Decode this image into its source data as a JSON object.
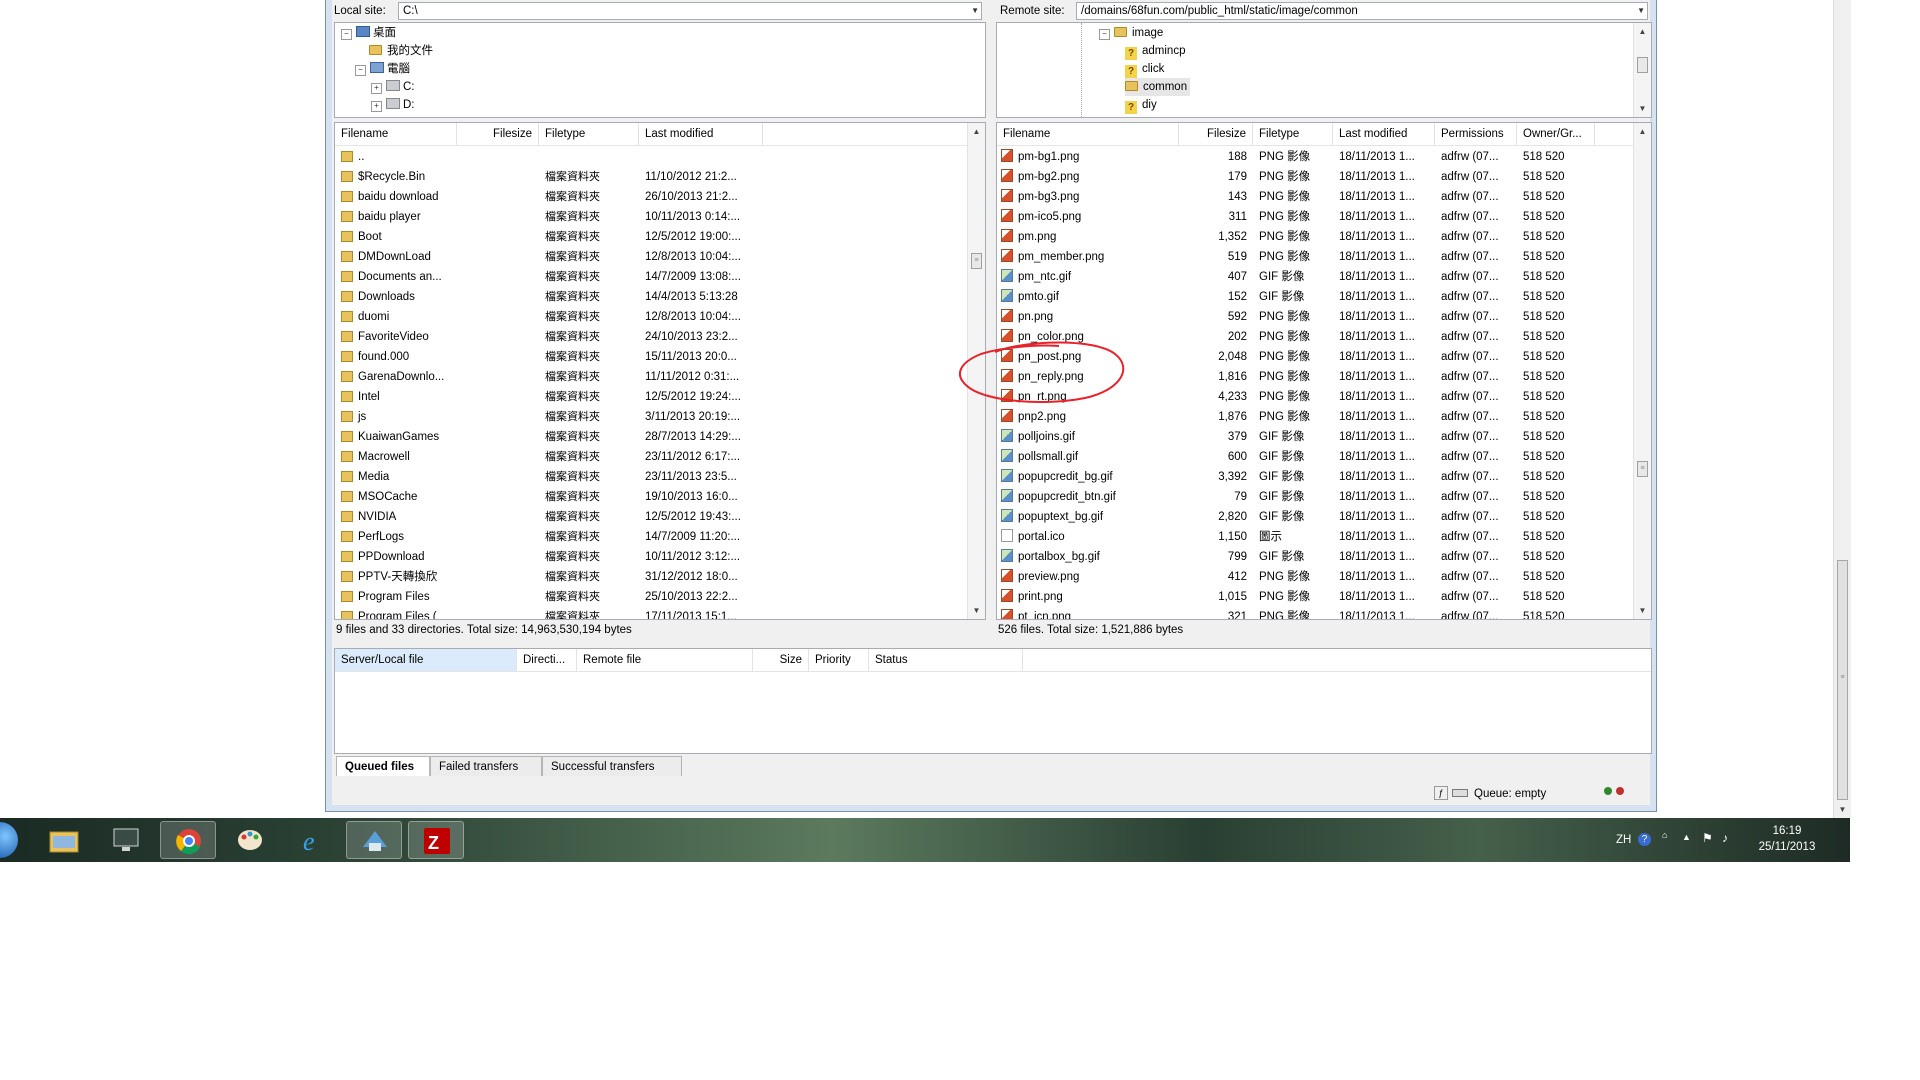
{
  "local": {
    "site_label": "Local site:",
    "site_path": "C:\\",
    "tree": [
      {
        "label": "桌面",
        "icon": "desktop-icon"
      },
      {
        "label": "我的文件",
        "icon": "folder-icon"
      },
      {
        "label": "電腦",
        "icon": "computer-icon"
      },
      {
        "label": "C:",
        "icon": "drive-icon"
      },
      {
        "label": "D:",
        "icon": "drive-icon"
      }
    ],
    "columns": [
      "Filename",
      "Filesize",
      "Filetype",
      "Last modified"
    ],
    "rows": [
      {
        "name": "..",
        "type": "",
        "modified": ""
      },
      {
        "name": "$Recycle.Bin",
        "type": "檔案資料夾",
        "modified": "11/10/2012 21:2..."
      },
      {
        "name": "baidu download",
        "type": "檔案資料夾",
        "modified": "26/10/2013 21:2..."
      },
      {
        "name": "baidu player",
        "type": "檔案資料夾",
        "modified": "10/11/2013 0:14:..."
      },
      {
        "name": "Boot",
        "type": "檔案資料夾",
        "modified": "12/5/2012 19:00:..."
      },
      {
        "name": "DMDownLoad",
        "type": "檔案資料夾",
        "modified": "12/8/2013 10:04:..."
      },
      {
        "name": "Documents an...",
        "type": "檔案資料夾",
        "modified": "14/7/2009 13:08:..."
      },
      {
        "name": "Downloads",
        "type": "檔案資料夾",
        "modified": "14/4/2013 5:13:28"
      },
      {
        "name": "duomi",
        "type": "檔案資料夾",
        "modified": "12/8/2013 10:04:..."
      },
      {
        "name": "FavoriteVideo",
        "type": "檔案資料夾",
        "modified": "24/10/2013 23:2..."
      },
      {
        "name": "found.000",
        "type": "檔案資料夾",
        "modified": "15/11/2013 20:0..."
      },
      {
        "name": "GarenaDownlo...",
        "type": "檔案資料夾",
        "modified": "11/11/2012 0:31:..."
      },
      {
        "name": "Intel",
        "type": "檔案資料夾",
        "modified": "12/5/2012 19:24:..."
      },
      {
        "name": "js",
        "type": "檔案資料夾",
        "modified": "3/11/2013 20:19:..."
      },
      {
        "name": "KuaiwanGames",
        "type": "檔案資料夾",
        "modified": "28/7/2013 14:29:..."
      },
      {
        "name": "Macrowell",
        "type": "檔案資料夾",
        "modified": "23/11/2012 6:17:..."
      },
      {
        "name": "Media",
        "type": "檔案資料夾",
        "modified": "23/11/2013 23:5..."
      },
      {
        "name": "MSOCache",
        "type": "檔案資料夾",
        "modified": "19/10/2013 16:0..."
      },
      {
        "name": "NVIDIA",
        "type": "檔案資料夾",
        "modified": "12/5/2012 19:43:..."
      },
      {
        "name": "PerfLogs",
        "type": "檔案資料夾",
        "modified": "14/7/2009 11:20:..."
      },
      {
        "name": "PPDownload",
        "type": "檔案資料夾",
        "modified": "10/11/2012 3:12:..."
      },
      {
        "name": "PPTV-天轉換欣",
        "type": "檔案資料夾",
        "modified": "31/12/2012 18:0..."
      },
      {
        "name": "Program Files",
        "type": "檔案資料夾",
        "modified": "25/10/2013 22:2..."
      },
      {
        "name": "Program Files (",
        "type": "檔案資料夾",
        "modified": "17/11/2013 15:1..."
      }
    ],
    "status": "9 files and 33 directories. Total size: 14,963,530,194 bytes"
  },
  "remote": {
    "site_label": "Remote site:",
    "site_path": "/domains/68fun.com/public_html/static/image/common",
    "tree": [
      {
        "label": "image",
        "icon": "folder-icon"
      },
      {
        "label": "admincp",
        "icon": "unknown-folder-icon"
      },
      {
        "label": "click",
        "icon": "unknown-folder-icon"
      },
      {
        "label": "common",
        "icon": "folder-icon"
      },
      {
        "label": "diy",
        "icon": "unknown-folder-icon"
      }
    ],
    "columns": [
      "Filename",
      "Filesize",
      "Filetype",
      "Last modified",
      "Permissions",
      "Owner/Gr..."
    ],
    "rows": [
      {
        "name": "pm-bg1.png",
        "size": "188",
        "type": "PNG 影像",
        "modified": "18/11/2013 1...",
        "perm": "adfrw (07...",
        "owner": "518 520",
        "icon": "png"
      },
      {
        "name": "pm-bg2.png",
        "size": "179",
        "type": "PNG 影像",
        "modified": "18/11/2013 1...",
        "perm": "adfrw (07...",
        "owner": "518 520",
        "icon": "png"
      },
      {
        "name": "pm-bg3.png",
        "size": "143",
        "type": "PNG 影像",
        "modified": "18/11/2013 1...",
        "perm": "adfrw (07...",
        "owner": "518 520",
        "icon": "png"
      },
      {
        "name": "pm-ico5.png",
        "size": "311",
        "type": "PNG 影像",
        "modified": "18/11/2013 1...",
        "perm": "adfrw (07...",
        "owner": "518 520",
        "icon": "png"
      },
      {
        "name": "pm.png",
        "size": "1,352",
        "type": "PNG 影像",
        "modified": "18/11/2013 1...",
        "perm": "adfrw (07...",
        "owner": "518 520",
        "icon": "png"
      },
      {
        "name": "pm_member.png",
        "size": "519",
        "type": "PNG 影像",
        "modified": "18/11/2013 1...",
        "perm": "adfrw (07...",
        "owner": "518 520",
        "icon": "png"
      },
      {
        "name": "pm_ntc.gif",
        "size": "407",
        "type": "GIF 影像",
        "modified": "18/11/2013 1...",
        "perm": "adfrw (07...",
        "owner": "518 520",
        "icon": "gif"
      },
      {
        "name": "pmto.gif",
        "size": "152",
        "type": "GIF 影像",
        "modified": "18/11/2013 1...",
        "perm": "adfrw (07...",
        "owner": "518 520",
        "icon": "gif"
      },
      {
        "name": "pn.png",
        "size": "592",
        "type": "PNG 影像",
        "modified": "18/11/2013 1...",
        "perm": "adfrw (07...",
        "owner": "518 520",
        "icon": "png"
      },
      {
        "name": "pn_color.png",
        "size": "202",
        "type": "PNG 影像",
        "modified": "18/11/2013 1...",
        "perm": "adfrw (07...",
        "owner": "518 520",
        "icon": "png"
      },
      {
        "name": "pn_post.png",
        "size": "2,048",
        "type": "PNG 影像",
        "modified": "18/11/2013 1...",
        "perm": "adfrw (07...",
        "owner": "518 520",
        "icon": "png"
      },
      {
        "name": "pn_reply.png",
        "size": "1,816",
        "type": "PNG 影像",
        "modified": "18/11/2013 1...",
        "perm": "adfrw (07...",
        "owner": "518 520",
        "icon": "png"
      },
      {
        "name": "pn_rt.png",
        "size": "4,233",
        "type": "PNG 影像",
        "modified": "18/11/2013 1...",
        "perm": "adfrw (07...",
        "owner": "518 520",
        "icon": "png"
      },
      {
        "name": "pnp2.png",
        "size": "1,876",
        "type": "PNG 影像",
        "modified": "18/11/2013 1...",
        "perm": "adfrw (07...",
        "owner": "518 520",
        "icon": "png"
      },
      {
        "name": "polljoins.gif",
        "size": "379",
        "type": "GIF 影像",
        "modified": "18/11/2013 1...",
        "perm": "adfrw (07...",
        "owner": "518 520",
        "icon": "gif"
      },
      {
        "name": "pollsmall.gif",
        "size": "600",
        "type": "GIF 影像",
        "modified": "18/11/2013 1...",
        "perm": "adfrw (07...",
        "owner": "518 520",
        "icon": "gif"
      },
      {
        "name": "popupcredit_bg.gif",
        "size": "3,392",
        "type": "GIF 影像",
        "modified": "18/11/2013 1...",
        "perm": "adfrw (07...",
        "owner": "518 520",
        "icon": "gif"
      },
      {
        "name": "popupcredit_btn.gif",
        "size": "79",
        "type": "GIF 影像",
        "modified": "18/11/2013 1...",
        "perm": "adfrw (07...",
        "owner": "518 520",
        "icon": "gif"
      },
      {
        "name": "popuptext_bg.gif",
        "size": "2,820",
        "type": "GIF 影像",
        "modified": "18/11/2013 1...",
        "perm": "adfrw (07...",
        "owner": "518 520",
        "icon": "gif"
      },
      {
        "name": "portal.ico",
        "size": "1,150",
        "type": "圖示",
        "modified": "18/11/2013 1...",
        "perm": "adfrw (07...",
        "owner": "518 520",
        "icon": "ico"
      },
      {
        "name": "portalbox_bg.gif",
        "size": "799",
        "type": "GIF 影像",
        "modified": "18/11/2013 1...",
        "perm": "adfrw (07...",
        "owner": "518 520",
        "icon": "gif"
      },
      {
        "name": "preview.png",
        "size": "412",
        "type": "PNG 影像",
        "modified": "18/11/2013 1...",
        "perm": "adfrw (07...",
        "owner": "518 520",
        "icon": "png"
      },
      {
        "name": "print.png",
        "size": "1,015",
        "type": "PNG 影像",
        "modified": "18/11/2013 1...",
        "perm": "adfrw (07...",
        "owner": "518 520",
        "icon": "png"
      },
      {
        "name": "pt_icn.png",
        "size": "321",
        "type": "PNG 影像",
        "modified": "18/11/2013 1...",
        "perm": "adfrw (07...",
        "owner": "518 520",
        "icon": "png"
      }
    ],
    "status": "526 files. Total size: 1,521,886 bytes"
  },
  "queue": {
    "columns": [
      "Server/Local file",
      "Directi...",
      "Remote file",
      "Size",
      "Priority",
      "Status"
    ],
    "tabs": [
      "Queued files",
      "Failed transfers",
      "Successful transfers"
    ],
    "status": "Queue: empty"
  },
  "taskbar": {
    "apps": [
      "start-orb-icon",
      "explorer-icon",
      "computer-monitor-icon",
      "chrome-icon",
      "paint-icon",
      "internet-explorer-icon",
      "network-tool-icon",
      "filezilla-icon"
    ],
    "lang": "ZH",
    "time": "16:19",
    "date": "25/11/2013"
  },
  "colors": {
    "annotation": "#e8222a",
    "window_frame": "#d6e2f0",
    "filezilla": "#bf0000"
  }
}
